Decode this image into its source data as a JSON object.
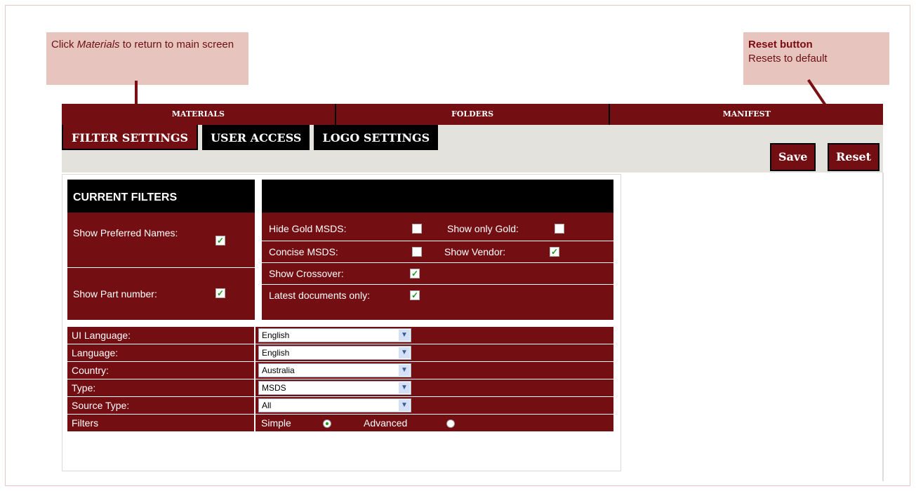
{
  "callouts": {
    "left": {
      "prefix": "Click ",
      "emphasis": "Materials",
      "suffix": " to return to main screen"
    },
    "right": {
      "title": "Reset button",
      "text": "Resets to default"
    }
  },
  "nav": [
    "MATERIALS",
    "FOLDERS",
    "MANIFEST"
  ],
  "tabs": [
    "FILTER SETTINGS",
    "USER ACCESS",
    "LOGO SETTINGS"
  ],
  "buttons": {
    "save": "Save",
    "reset": "Reset"
  },
  "current_filters": {
    "title": "CURRENT FILTERS",
    "show_preferred_names": {
      "label": "Show Preferred Names:",
      "checked": true
    },
    "show_part_number": {
      "label": "Show Part number:",
      "checked": true
    }
  },
  "right_filters": {
    "hide_gold_msds": {
      "label": "Hide Gold MSDS:",
      "checked": false
    },
    "show_only_gold": {
      "label": "Show only Gold:",
      "checked": false
    },
    "concise_msds": {
      "label": "Concise MSDS:",
      "checked": false
    },
    "show_vendor": {
      "label": "Show Vendor:",
      "checked": true
    },
    "show_crossover": {
      "label": "Show Crossover:",
      "checked": true
    },
    "latest_documents_only": {
      "label": "Latest documents only:",
      "checked": true
    }
  },
  "settings": {
    "ui_language": {
      "label": "UI Language:",
      "value": "English"
    },
    "language": {
      "label": "Language:",
      "value": "English"
    },
    "country": {
      "label": "Country:",
      "value": "Australia"
    },
    "type": {
      "label": "Type:",
      "value": "MSDS"
    },
    "source_type": {
      "label": "Source Type:",
      "value": "All"
    },
    "filters": {
      "label": "Filters",
      "simple": "Simple",
      "advanced": "Advanced",
      "selected": "Simple"
    }
  },
  "icons": {
    "checkbox_checked": "checkmark-icon",
    "dropdown": "chevron-down-icon"
  },
  "colors": {
    "maroon": "#730e12",
    "callout": "#e8c4bf",
    "check": "#1a9a1a"
  }
}
